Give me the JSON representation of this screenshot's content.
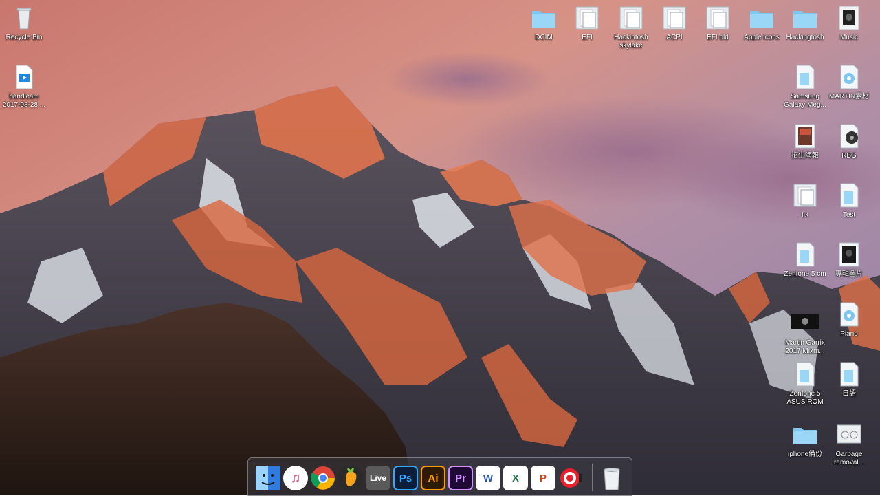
{
  "desktop": {
    "left_icons": [
      {
        "label": "Recycle Bin",
        "icon": "recycle-bin-icon"
      },
      {
        "label": "bandicam 2017-08-28 ...",
        "icon": "video-file-icon"
      }
    ],
    "top_row_icons": [
      {
        "label": "DCIM",
        "icon": "folder-icon"
      },
      {
        "label": "EFI",
        "icon": "file-folder-icon"
      },
      {
        "label": "Hackintosh skylake",
        "icon": "file-folder-icon"
      },
      {
        "label": "ACPI",
        "icon": "file-folder-icon"
      },
      {
        "label": "EFI old",
        "icon": "file-folder-icon"
      },
      {
        "label": "Apple icons",
        "icon": "folder-icon"
      },
      {
        "label": "Hackingtosh",
        "icon": "folder-icon"
      },
      {
        "label": "Music",
        "icon": "music-folder-icon"
      }
    ],
    "right_icons": [
      {
        "label": "Samsung Galaxy Meg...",
        "icon": "document-folder-icon"
      },
      {
        "label": "MARTIN素材",
        "icon": "document-folder-icon"
      },
      {
        "label": "招生海報",
        "icon": "image-folder-icon"
      },
      {
        "label": "RBG",
        "icon": "music-folder-icon"
      },
      {
        "label": "fix",
        "icon": "file-folder-icon"
      },
      {
        "label": "Test",
        "icon": "document-folder-icon"
      },
      {
        "label": "Zenfone 5 cm",
        "icon": "document-folder-icon"
      },
      {
        "label": "專輯圖片",
        "icon": "image-folder-icon"
      },
      {
        "label": "Martin Garrix 2017 Mixm...",
        "icon": "video-thumbnail-icon"
      },
      {
        "label": "Piano",
        "icon": "music-folder-icon"
      },
      {
        "label": "Zenfone 5 ASUS ROM",
        "icon": "document-folder-icon"
      },
      {
        "label": "日語",
        "icon": "document-folder-icon"
      },
      {
        "label": "iphone備份",
        "icon": "folder-icon"
      },
      {
        "label": "Garbage removal...",
        "icon": "image-file-icon"
      }
    ]
  },
  "dock": {
    "apps": [
      {
        "name": "Finder",
        "icon": "finder-icon",
        "text": "",
        "bg": "#3b8ff2"
      },
      {
        "name": "iTunes",
        "icon": "itunes-icon",
        "text": "♫",
        "bg": "#ffffff"
      },
      {
        "name": "Chrome",
        "icon": "chrome-icon",
        "text": "",
        "bg": "#e8453c"
      },
      {
        "name": "FL Studio",
        "icon": "fl-studio-icon",
        "text": "",
        "bg": "#2a2a2a"
      },
      {
        "name": "Ableton Live",
        "icon": "ableton-live-icon",
        "text": "Live",
        "bg": "#5a5a5a"
      },
      {
        "name": "Photoshop",
        "icon": "photoshop-icon",
        "text": "Ps",
        "bg": "#0d1e3a"
      },
      {
        "name": "Illustrator",
        "icon": "illustrator-icon",
        "text": "Ai",
        "bg": "#2f1a05"
      },
      {
        "name": "Premiere Pro",
        "icon": "premiere-icon",
        "text": "Pr",
        "bg": "#1f0a35"
      },
      {
        "name": "Word",
        "icon": "word-icon",
        "text": "W",
        "bg": "#ffffff"
      },
      {
        "name": "Excel",
        "icon": "excel-icon",
        "text": "X",
        "bg": "#ffffff"
      },
      {
        "name": "PowerPoint",
        "icon": "powerpoint-icon",
        "text": "P",
        "bg": "#ffffff"
      },
      {
        "name": "Target app",
        "icon": "target-icon",
        "text": "",
        "bg": "#e8202a"
      },
      {
        "name": "Trash",
        "icon": "trash-icon",
        "text": "",
        "bg": "transparent"
      }
    ]
  },
  "colors": {
    "folder_blue": "#7cc6ef",
    "accent_word": "#2b579a",
    "accent_excel": "#217346",
    "accent_powerpoint": "#d24726"
  }
}
